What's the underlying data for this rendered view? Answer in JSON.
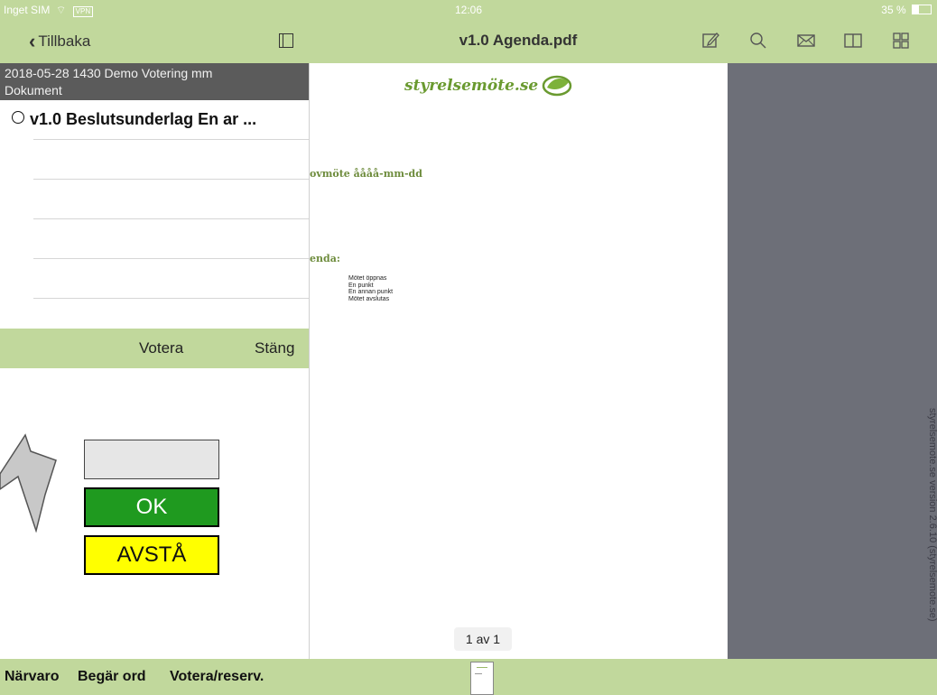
{
  "status_bar": {
    "carrier": "Inget SIM",
    "vpn": "VPN",
    "time": "12:06",
    "battery": "35 %",
    "battery_level": 0.35
  },
  "nav": {
    "back_label": "Tillbaka",
    "doc_title": "v1.0 Agenda.pdf",
    "icons": [
      "annotate-icon",
      "search-icon",
      "mail-icon",
      "book-icon",
      "grid-icon"
    ]
  },
  "sidebar": {
    "meeting_line1": "2018-05-28 1430  Demo Votering mm",
    "meeting_line2": "Dokument",
    "item_title": "v1.0 Beslutsunderlag En ar ...",
    "vote_label": "Votera",
    "close_label": "Stäng"
  },
  "vote_buttons": {
    "blank": "",
    "ok": "OK",
    "abstain": "AVSTÅ"
  },
  "pdf": {
    "logo_text": "styrelsemöte.se",
    "heading": "ovmöte åååå-mm-dd",
    "agenda_label": "enda:",
    "agenda_items": [
      "Mötet öppnas",
      "En punkt",
      "En annan punkt",
      "Mötet avslutas"
    ],
    "page_indicator": "1 av 1"
  },
  "side_text": "styrelsemote.se version 2.6.10 (styrelsemote.se)",
  "bottom": {
    "attendance": "Närvaro",
    "request_word": "Begär ord",
    "vote_reserve": "Votera/reserv."
  },
  "colors": {
    "green_bar": "#c1d89c",
    "dark_header": "#5b5b5b",
    "ok_green": "#1f9a1f",
    "abstain_yellow": "#ffff00",
    "gray_panel": "#6d6f78"
  }
}
